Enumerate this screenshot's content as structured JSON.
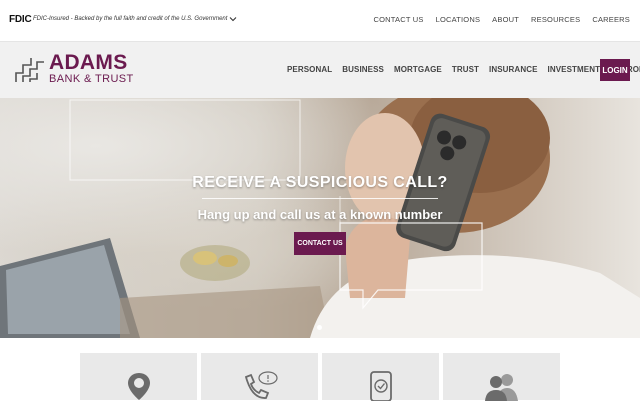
{
  "fdic": {
    "logo": "FDIC",
    "text": "FDIC-Insured - Backed by the full faith and credit of the U.S. Government"
  },
  "utility_nav": [
    "CONTACT US",
    "LOCATIONS",
    "ABOUT",
    "RESOURCES",
    "CAREERS"
  ],
  "brand": {
    "name": "ADAMS",
    "sub": "BANK & TRUST",
    "color": "#6b1a4f"
  },
  "main_nav": [
    "PERSONAL",
    "BUSINESS",
    "MORTGAGE",
    "TRUST",
    "INSURANCE",
    "INVESTMENTS",
    "ENROLL"
  ],
  "login_label": "LOGIN",
  "hero": {
    "title": "RECEIVE A SUSPICIOUS CALL?",
    "subtitle": "Hang up and call us at a known number",
    "button": "CONTACT US"
  },
  "cards": [
    {
      "icon": "location-pin-icon"
    },
    {
      "icon": "phone-alert-icon"
    },
    {
      "icon": "mobile-check-icon"
    },
    {
      "icon": "users-icon"
    }
  ]
}
